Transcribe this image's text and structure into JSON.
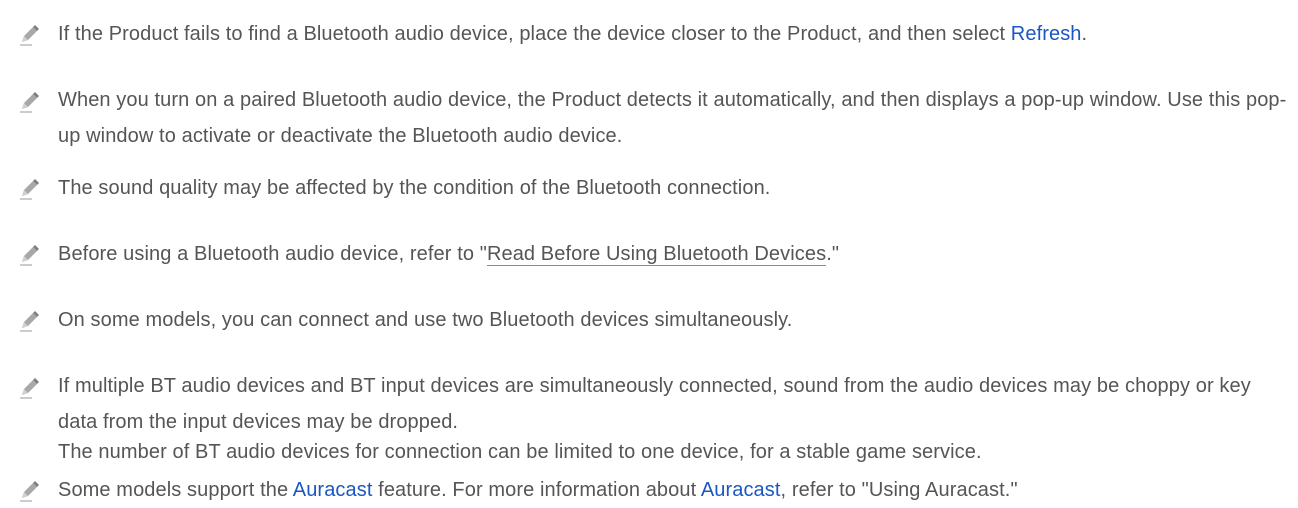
{
  "notes": [
    {
      "pre": "If the Product fails to find a Bluetooth audio device, place the device closer to the Product, and then select ",
      "link": "Refresh",
      "post": "."
    },
    {
      "text": "When you turn on a paired Bluetooth audio device, the Product detects it automatically, and then displays a pop-up window. Use this pop-up window to activate or deactivate the Bluetooth audio device."
    },
    {
      "text": "The sound quality may be affected by the condition of the Bluetooth connection."
    },
    {
      "pre": "Before using a Bluetooth audio device, refer to \"",
      "link": "Read Before Using Bluetooth Devices",
      "post": ".\""
    },
    {
      "text": "On some models, you can connect and use two Bluetooth devices simultaneously."
    },
    {
      "text": "If multiple BT audio devices and BT input devices are simultaneously connected, sound from the audio devices may be choppy or key data from the input devices may be dropped."
    },
    {
      "text": "The number of BT audio devices for connection can be limited to one device, for a stable game service."
    },
    {
      "pre": "Some models support the ",
      "link1": "Auracast",
      "mid": " feature. For more information about ",
      "link2": "Auracast",
      "post": ", refer to \"Using Auracast.\""
    }
  ],
  "colors": {
    "text": "#555555",
    "link": "#1a56c4",
    "icon": "#9a9a9a"
  },
  "icon": "pencil-icon"
}
